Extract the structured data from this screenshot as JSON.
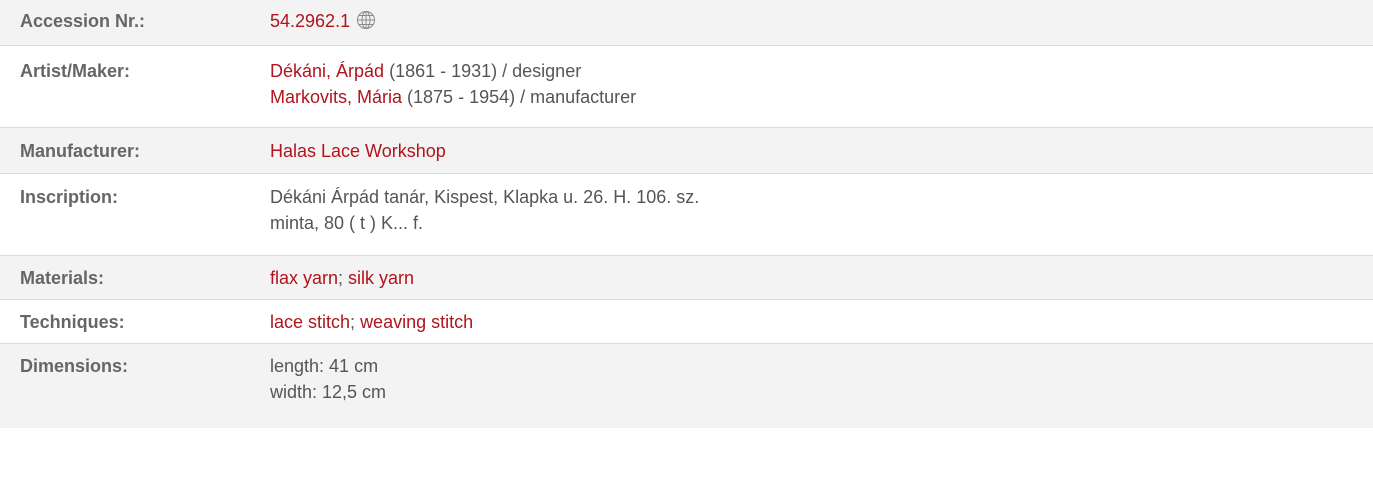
{
  "accession": {
    "label": "Accession Nr.:",
    "value": "54.2962.1",
    "icon": "globe-icon"
  },
  "artist": {
    "label": "Artist/Maker:",
    "entries": [
      {
        "name": "Dékáni, Árpád",
        "details": " (1861 - 1931) / designer"
      },
      {
        "name": "Markovits, Mária",
        "details": " (1875 - 1954) / manufacturer"
      }
    ]
  },
  "manufacturer": {
    "label": "Manufacturer:",
    "value": "Halas Lace Workshop"
  },
  "inscription": {
    "label": "Inscription:",
    "lines": [
      "Dékáni Árpád tanár, Kispest, Klapka u. 26. H. 106. sz.",
      "minta, 80 ( t ) K... f."
    ]
  },
  "materials": {
    "label": "Materials:",
    "items": [
      "flax yarn",
      "silk yarn"
    ],
    "separator": "; "
  },
  "techniques": {
    "label": "Techniques:",
    "items": [
      "lace stitch",
      "weaving stitch"
    ],
    "separator": "; "
  },
  "dimensions": {
    "label": "Dimensions:",
    "lines": [
      "length: 41 cm",
      "width: 12,5 cm"
    ]
  },
  "colors": {
    "link": "#b0141c",
    "shaded_row": "#f3f3f3",
    "text": "#555555",
    "divider": "#dcdcdc"
  }
}
